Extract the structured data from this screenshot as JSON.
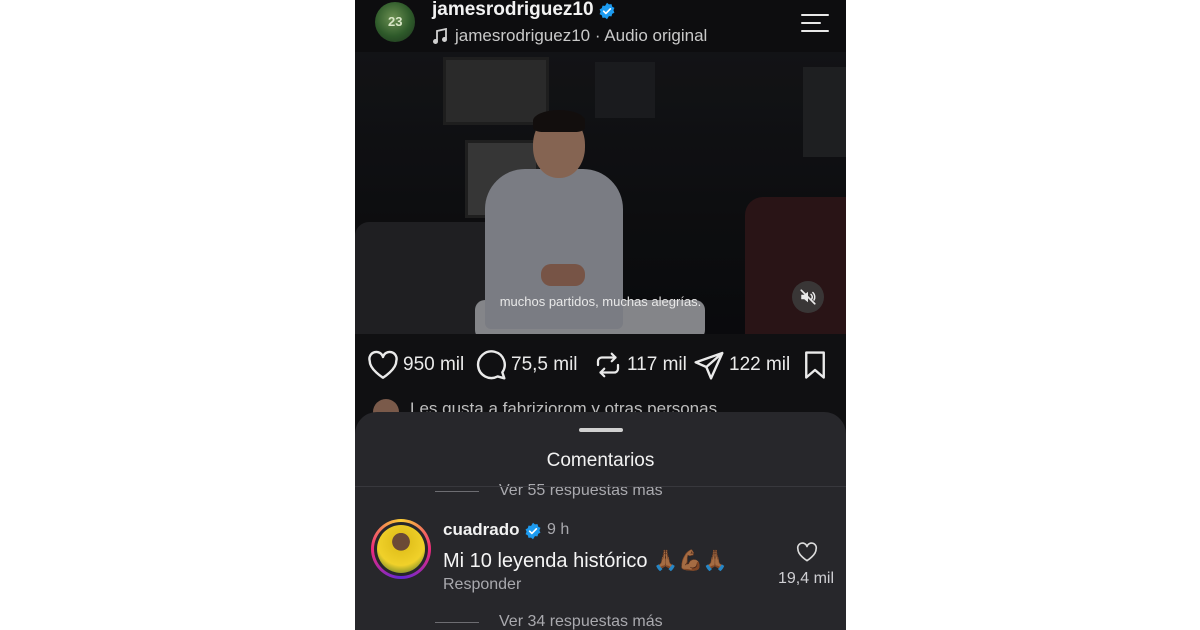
{
  "header": {
    "username": "jamesrodriguez10",
    "audio": "jamesrodriguez10 · Audio original",
    "avatar_number": "23"
  },
  "video": {
    "subtitle": "muchos partidos, muchas alegrías."
  },
  "actions": {
    "likes": "950 mil",
    "comments": "75,5 mil",
    "reposts": "117 mil",
    "shares": "122 mil"
  },
  "liked_by": "Les gusta a fabriziorom y otras personas",
  "comments_sheet": {
    "title": "Comentarios",
    "view_replies_top": "Ver 55 respuestas mas",
    "view_replies_bottom": "Ver 34 respuestas más",
    "comment": {
      "user": "cuadrado",
      "time": "9 h",
      "text": "Mi 10 leyenda histórico 🙏🏾💪🏾🙏🏾",
      "reply_label": "Responder",
      "like_count": "19,4 mil"
    }
  },
  "colors": {
    "verified": "#1d9bf0",
    "background": "#101012",
    "sheet": "#27272b"
  }
}
